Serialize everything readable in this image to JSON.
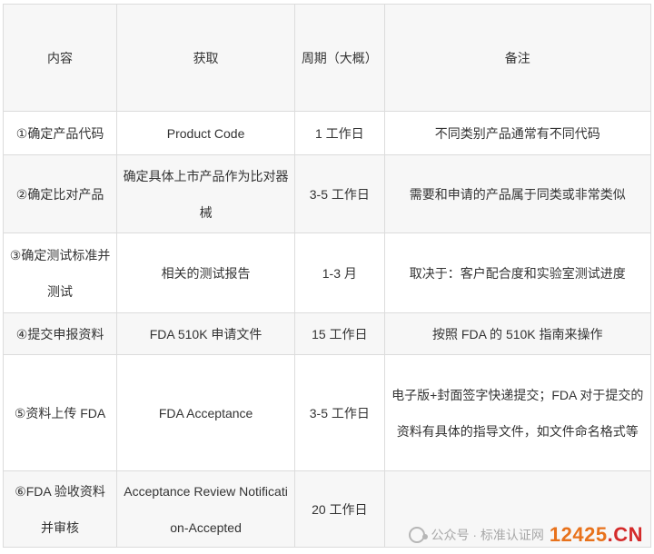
{
  "table": {
    "headers": [
      "内容",
      "获取",
      "周期（大概）",
      "备注"
    ],
    "rows": [
      {
        "content": "①确定产品代码",
        "obtain": "Product Code",
        "period": "1 工作日",
        "note": "不同类别产品通常有不同代码"
      },
      {
        "content": "②确定比对产品",
        "obtain": "确定具体上市产品作为比对器械",
        "period": "3-5 工作日",
        "note": "需要和申请的产品属于同类或非常类似"
      },
      {
        "content": "③确定测试标准并测试",
        "obtain": "相关的测试报告",
        "period": "1-3 月",
        "note": "取决于：客户配合度和实验室测试进度"
      },
      {
        "content": "④提交申报资料",
        "obtain": "FDA 510K 申请文件",
        "period": "15 工作日",
        "note": "按照 FDA 的 510K 指南来操作"
      },
      {
        "content": "⑤资料上传 FDA",
        "obtain": "FDA Acceptance",
        "period": "3-5 工作日",
        "note": "电子版+封面签字快递提交；FDA 对于提交的资料有具体的指导文件，如文件命名格式等"
      },
      {
        "content": "⑥FDA 验收资料并审核",
        "obtain": "Acceptance Review Notification-Accepted",
        "period": "20 工作日",
        "note": ""
      }
    ]
  },
  "watermark": {
    "label": "公众号 · 标准认证网",
    "badge_digits": "12425",
    "badge_suffix": ".CN",
    "icon": "wechat-icon"
  }
}
